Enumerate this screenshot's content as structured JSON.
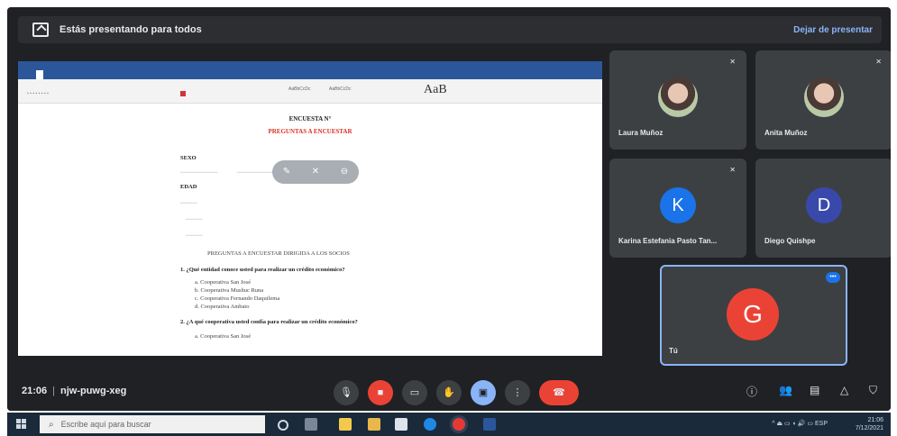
{
  "topbar": {
    "presenting_text": "Estás presentando para todos",
    "stop_label": "Dejar de presentar"
  },
  "shared_doc": {
    "ribbon_style": "AaB",
    "ribbon_a": "AaBbCcDc",
    "ribbon_b": "AaBbCcDc",
    "heading": "ENCUESTA N°",
    "subheading": "PREGUNTAS A ENCUESTAR",
    "field_sexo": "SEXO",
    "field_edad": "EDAD",
    "section_title": "PREGUNTAS A ENCUESTAR DIRIGIDA A LOS SOCIOS",
    "question1": "1. ¿Qué entidad conoce usted para realizar un crédito económico?",
    "question1_options": [
      "a. Cooperativa San José",
      "b. Cooperativa Mushuc Runa",
      "c. Cooperativa Fernando Daquilema",
      "d. Cooperativa Ambato"
    ],
    "question2": "2. ¿A qué cooperativa usted confía para realizar un crédito económico?",
    "question2_options": [
      "a. Cooperativa San José"
    ]
  },
  "participants": [
    {
      "name": "Laura Muñoz",
      "avatar": "photo",
      "muted": true
    },
    {
      "name": "Anita Muñoz",
      "avatar": "photo",
      "muted": true
    },
    {
      "name": "Karina Estefania Pasto Tan...",
      "avatar": "K",
      "color": "#1a73e8",
      "muted": true
    },
    {
      "name": "Diego Quishpe",
      "avatar": "D",
      "color": "#3949ab",
      "muted": false
    }
  ],
  "self": {
    "name": "Tú",
    "avatar": "G",
    "color": "#ea4335"
  },
  "meeting": {
    "time": "21:06",
    "code": "njw-puwg-xeg"
  },
  "taskbar": {
    "search_placeholder": "Escribe aquí para buscar",
    "lang": "ESP",
    "clock_time": "21:06",
    "clock_date": "7/12/2021"
  },
  "colors": {
    "accent": "#8ab4f8",
    "end_call": "#ea4335",
    "background": "#202124"
  }
}
